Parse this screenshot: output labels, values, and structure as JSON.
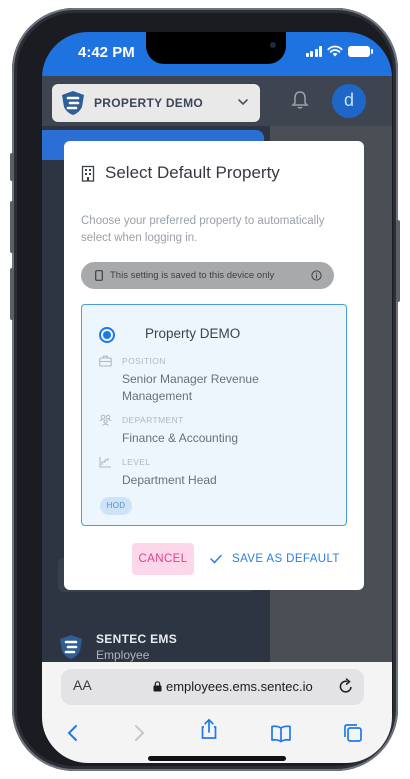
{
  "status_bar": {
    "time": "4:42 PM"
  },
  "header": {
    "property_selector": "PROPERTY DEMO",
    "avatar_initial": "d"
  },
  "sidebar": {
    "brand_name": "SENTEC EMS",
    "brand_role": "Employee"
  },
  "modal": {
    "title": "Select Default Property",
    "description": "Choose your preferred property to automatically select when logging in.",
    "notice": "This setting is saved to this device only",
    "property": {
      "name": "Property DEMO",
      "selected": true,
      "fields": [
        {
          "label": "POSITION",
          "value": "Senior Manager Revenue Management",
          "icon": "briefcase-icon"
        },
        {
          "label": "DEPARTMENT",
          "value": "Finance & Accounting",
          "icon": "people-icon"
        },
        {
          "label": "LEVEL",
          "value": "Department Head",
          "icon": "level-icon"
        }
      ],
      "badge": "HOD"
    },
    "cancel_label": "CANCEL",
    "save_label": "SAVE AS DEFAULT"
  },
  "browser": {
    "text_size_label": "AA",
    "url": "employees.ems.sentec.io"
  },
  "colors": {
    "accent": "#1f73e0",
    "cancel": "#e3408a",
    "save": "#2b7de0",
    "card_border": "#4a9be3"
  }
}
